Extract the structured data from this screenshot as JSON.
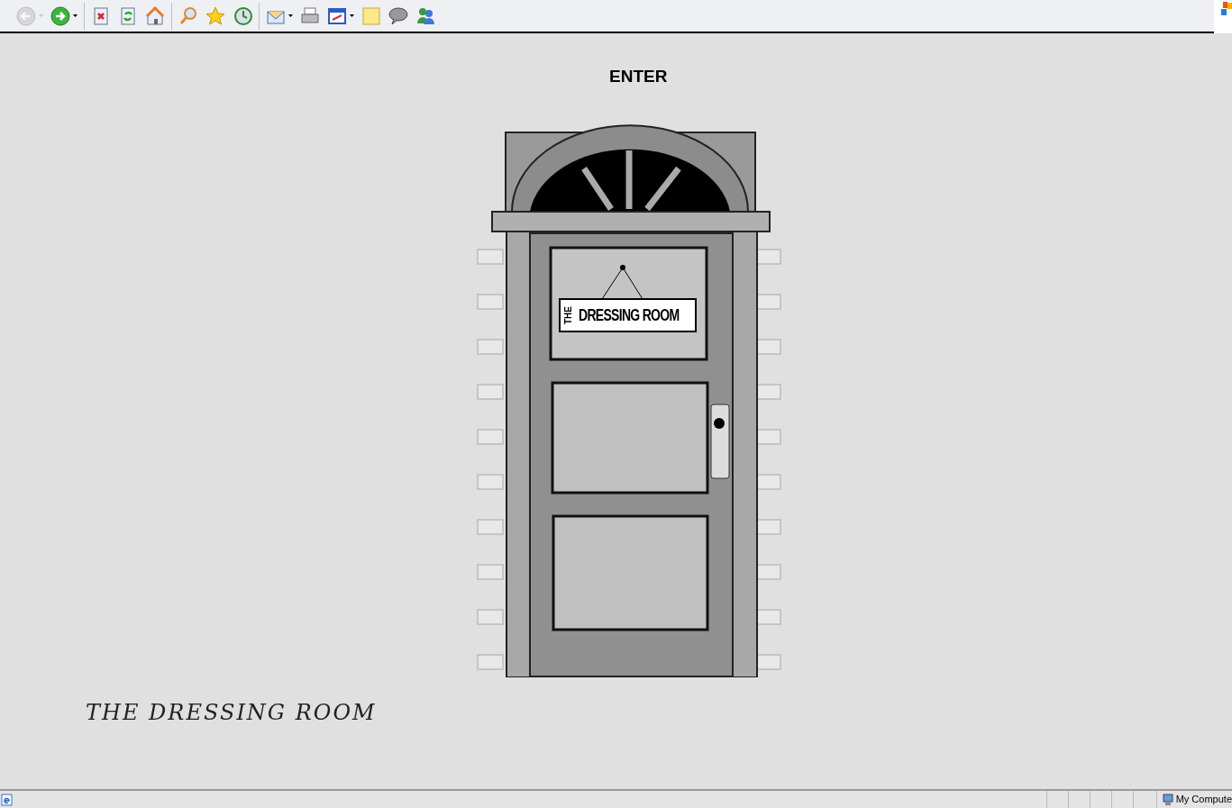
{
  "toolbar": [
    {
      "disabled": true,
      "dropdown": true
    },
    {
      "disabled": false,
      "dropdown": true
    },
    {
      "disabled": false,
      "dropdown": false
    },
    {
      "disabled": false,
      "dropdown": false
    },
    {
      "disabled": false,
      "dropdown": false
    },
    {
      "disabled": false,
      "dropdown": false
    },
    {
      "disabled": false,
      "dropdown": false
    },
    {
      "disabled": false,
      "dropdown": false
    },
    {
      "disabled": false,
      "dropdown": true
    },
    {
      "disabled": false,
      "dropdown": false
    },
    {
      "disabled": false,
      "dropdown": true
    },
    {
      "disabled": false,
      "dropdown": false
    },
    {
      "disabled": false,
      "dropdown": false
    },
    {
      "disabled": false,
      "dropdown": false
    }
  ],
  "page": {
    "heading": "ENTER",
    "sign_small": "THE",
    "sign_large": "DRESSING ROOM",
    "footer_title": "THE DRESSING ROOM"
  },
  "status_bar": {
    "zone": "My Compute"
  }
}
